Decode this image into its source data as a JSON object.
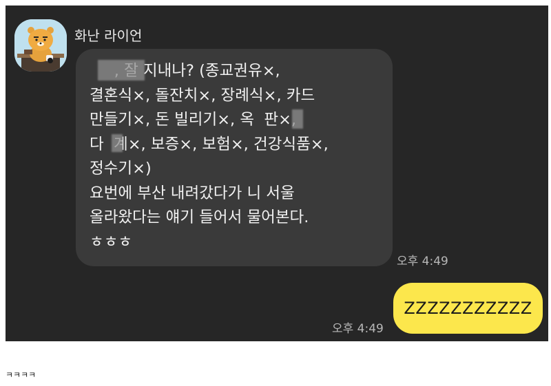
{
  "chat": {
    "sender_name": "화난 라이언",
    "avatar_icon": "ryan-character-avatar",
    "received_message": {
      "text": "     , 잘 지내나? (종교권유×,\n결혼식×, 돌잔치×, 장례식×, 카드\n만들기×, 돈 빌리기×, 옥  판×,\n다  계×, 보증×, 보험×, 건강식품×,\n정수기×)\n요번에 부산 내려갔다가 니 서울\n올라왔다는 얘기 들어서 물어본다.\nㅎㅎㅎ",
      "time": "오후 4:49"
    },
    "sent_message": {
      "text": "ZZZZZZZZZZZ",
      "time": "오후 4:49"
    }
  },
  "caption": "ㅋㅋㅋㅋ",
  "colors": {
    "background": "#262626",
    "received_bubble": "#3a3a3a",
    "sent_bubble": "#fce74c",
    "avatar_bg": "#bfe0ee"
  }
}
